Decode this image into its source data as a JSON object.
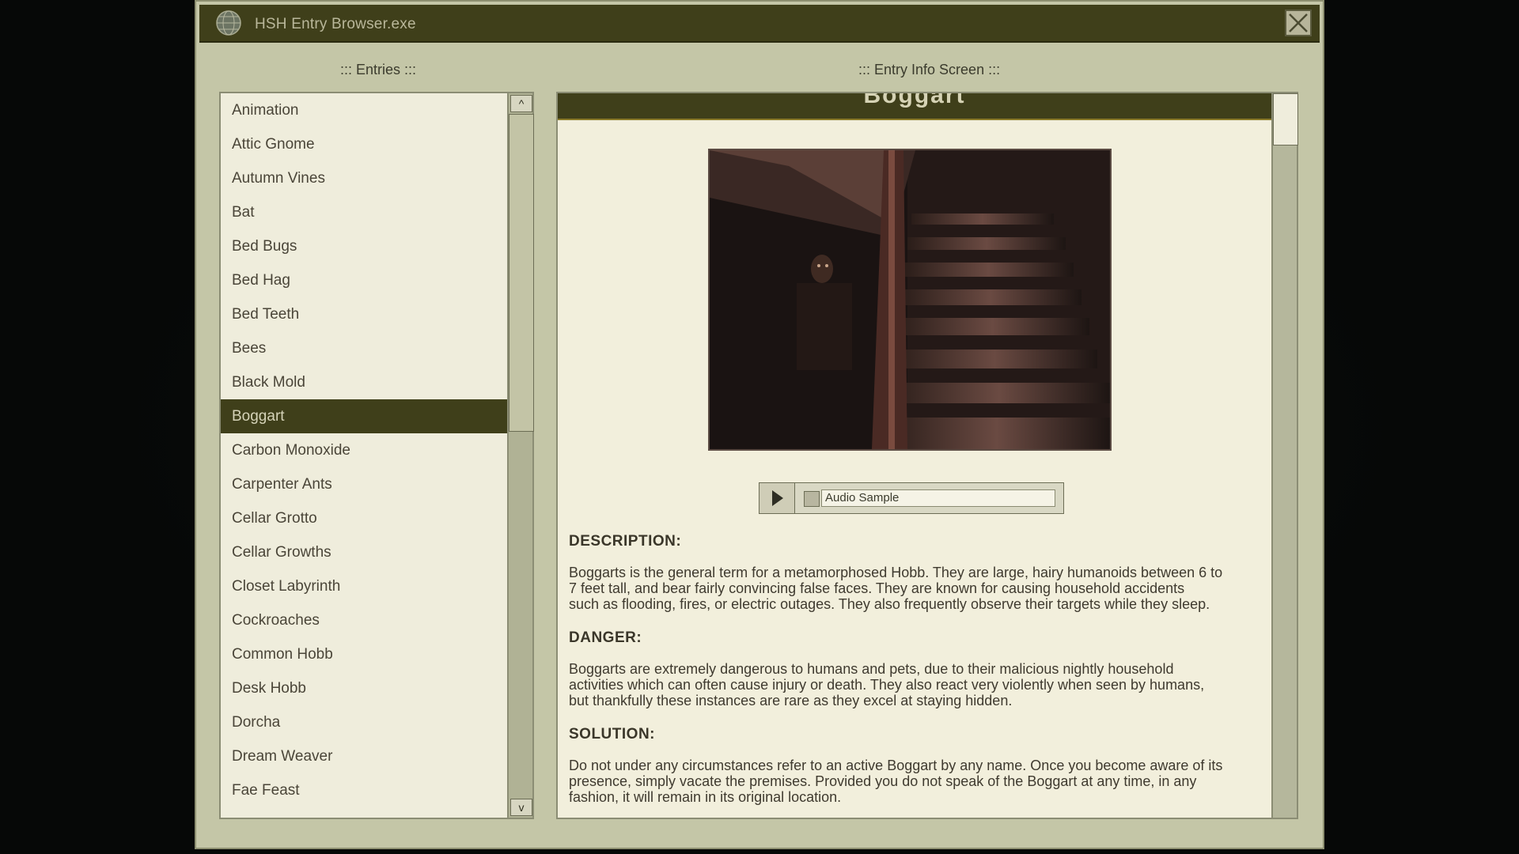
{
  "window": {
    "title": "HSH Entry Browser.exe",
    "close_symbol": "×"
  },
  "entries_panel": {
    "label": "::: Entries :::",
    "scroll_up": "^",
    "scroll_down": "v",
    "items": [
      {
        "label": "Animation"
      },
      {
        "label": "Attic Gnome"
      },
      {
        "label": "Autumn Vines"
      },
      {
        "label": "Bat"
      },
      {
        "label": "Bed Bugs"
      },
      {
        "label": "Bed Hag"
      },
      {
        "label": "Bed Teeth"
      },
      {
        "label": "Bees"
      },
      {
        "label": "Black Mold"
      },
      {
        "label": "Boggart",
        "selected": true
      },
      {
        "label": "Carbon Monoxide"
      },
      {
        "label": "Carpenter Ants"
      },
      {
        "label": "Cellar Grotto"
      },
      {
        "label": "Cellar Growths"
      },
      {
        "label": "Closet Labyrinth"
      },
      {
        "label": "Cockroaches"
      },
      {
        "label": "Common Hobb"
      },
      {
        "label": "Desk Hobb"
      },
      {
        "label": "Dorcha"
      },
      {
        "label": "Dream Weaver"
      },
      {
        "label": "Fae Feast"
      }
    ]
  },
  "info_panel": {
    "label": "::: Entry Info Screen :::",
    "header_title": "Boggart",
    "audio_label": "Audio Sample",
    "sections": [
      {
        "heading": "DESCRIPTION:",
        "lines": [
          "Boggarts is the general term for a metamorphosed Hobb. They are large, hairy humanoids between 6 to",
          "7 feet tall, and bear fairly convincing false faces. They are known for causing household accidents",
          "such as flooding, fires, or electric outages. They also frequently observe their targets while they sleep."
        ]
      },
      {
        "heading": "DANGER:",
        "lines": [
          "Boggarts are extremely dangerous to humans and pets, due to their malicious nightly household",
          "activities which can often cause injury or death. They also react very violently when seen by humans,",
          "but thankfully these instances are rare as they excel at staying hidden."
        ]
      },
      {
        "heading": "SOLUTION:",
        "lines": [
          "Do not under any circumstances refer to an active Boggart by any name. Once you become aware of its",
          "presence, simply vacate the premises. Provided you do not speak of the Boggart at any time, in any",
          "fashion, it will remain in its original location."
        ]
      }
    ]
  },
  "colors": {
    "titlebar": "#3f3f1a",
    "window_bg": "#c4c6a7",
    "panel_bg": "#efeddc",
    "selected_bg": "#3f3f1a",
    "text": "#4a4538"
  }
}
